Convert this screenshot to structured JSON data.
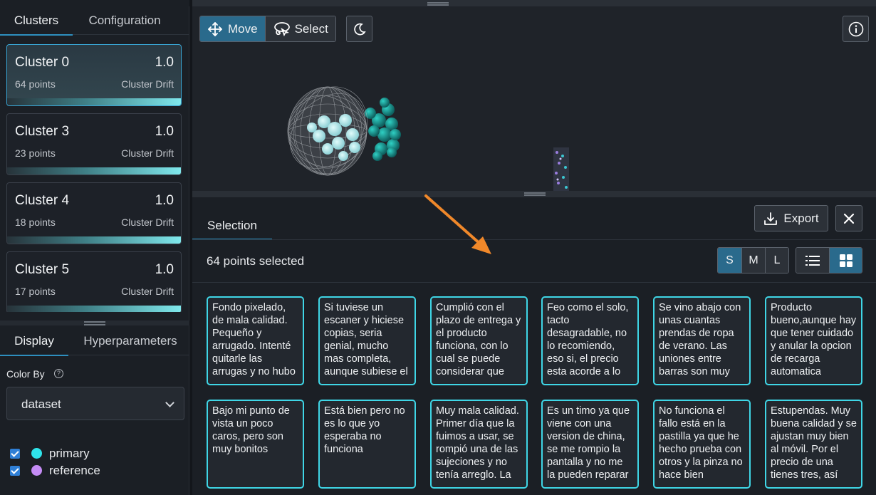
{
  "left_panel": {
    "tabs": [
      "Clusters",
      "Configuration"
    ],
    "clusters": [
      {
        "name": "Cluster 0",
        "score": "1.0",
        "points": "64 points",
        "metric": "Cluster Drift"
      },
      {
        "name": "Cluster 3",
        "score": "1.0",
        "points": "23 points",
        "metric": "Cluster Drift"
      },
      {
        "name": "Cluster 4",
        "score": "1.0",
        "points": "18 points",
        "metric": "Cluster Drift"
      },
      {
        "name": "Cluster 5",
        "score": "1.0",
        "points": "17 points",
        "metric": "Cluster Drift"
      }
    ],
    "bottom_tabs": [
      "Display",
      "Hyperparameters"
    ],
    "color_by_label": "Color By",
    "color_by_value": "dataset",
    "legend": [
      {
        "label": "primary",
        "color": "#2fe3ea",
        "checked": true
      },
      {
        "label": "reference",
        "color": "#c58cf5",
        "checked": true
      }
    ]
  },
  "toolbar": {
    "move_label": "Move",
    "select_label": "Select",
    "active_tool": "Move"
  },
  "selection": {
    "tab_label": "Selection",
    "export_label": "Export",
    "count_text": "64 points selected",
    "sizes": [
      "S",
      "M",
      "L"
    ],
    "active_size": "S",
    "active_view": "grid",
    "cards": [
      "Fondo pixelado, de mala calidad. Pequeño y arrugado. Intenté quitarle las arrugas y no hubo",
      "Si tuviese un escaner y hiciese copias, seria genial, mucho mas completa, aunque subiese el",
      "Cumplió con el plazo de entrega y el producto funciona, con lo cual se puede considerar que",
      "Feo como el solo, tacto desagradable, no lo recomiendo, eso si, el precio esta acorde a lo",
      "Se vino abajo con unas cuantas prendas de ropa de verano. Las uniones entre barras son muy",
      "Producto bueno,aunque hay que tener cuidado y anular la opcion de recarga automatica",
      "Bajo mi punto de vista un poco caros, pero son muy bonitos",
      "Está bien pero no es lo que yo esperaba no funciona",
      "Muy mala calidad. Primer día que la fuimos a usar, se rompió una de las sujeciones y no tenía arreglo. La",
      "Es un timo ya que viene con una version de china, se me rompio la pantalla y no me la pueden reparar",
      "No funciona el fallo está en la pastilla ya que he hecho prueba con otros y la pinza no hace bien",
      "Estupendas. Muy buena calidad y se ajustan muy bien al móvil. Por el precio de una tienes tres, así"
    ]
  },
  "colors": {
    "accent": "#2e8fbf",
    "card_border": "#3fd6e6",
    "arrow": "#f0882a"
  }
}
